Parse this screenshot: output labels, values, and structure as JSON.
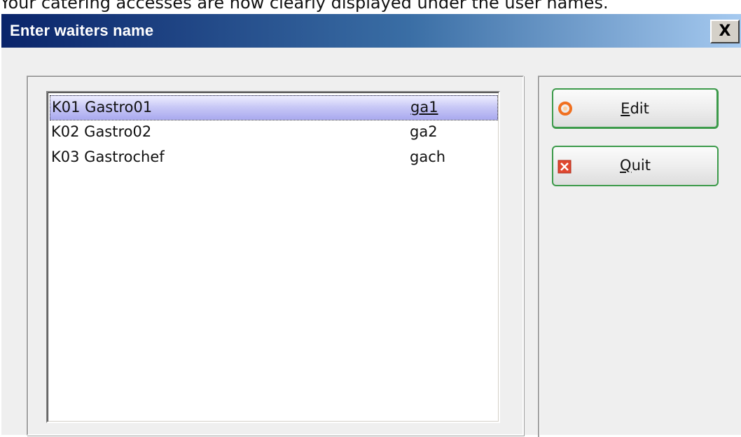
{
  "caption": "Your catering accesses are now clearly displayed under the user names.",
  "window": {
    "title": "Enter waiters name",
    "close_label": "X"
  },
  "list": {
    "rows": [
      {
        "name": "K01 Gastro01",
        "code": "ga1"
      },
      {
        "name": "K02 Gastro02",
        "code": "ga2"
      },
      {
        "name": "K03 Gastrochef",
        "code": "gach"
      }
    ],
    "selected_index": 0
  },
  "buttons": {
    "edit": {
      "mnemonic": "E",
      "rest": "dit",
      "icon": "edit-circle-icon"
    },
    "quit": {
      "mnemonic": "Q",
      "rest": "uit",
      "icon": "quit-x-icon"
    }
  },
  "colors": {
    "titlebar_start": "#0a246a",
    "titlebar_end": "#a6caf0",
    "button_border": "#3c9a4a",
    "edit_icon": "#f07020",
    "quit_icon": "#e04830",
    "selection": "#b8b8f2"
  }
}
